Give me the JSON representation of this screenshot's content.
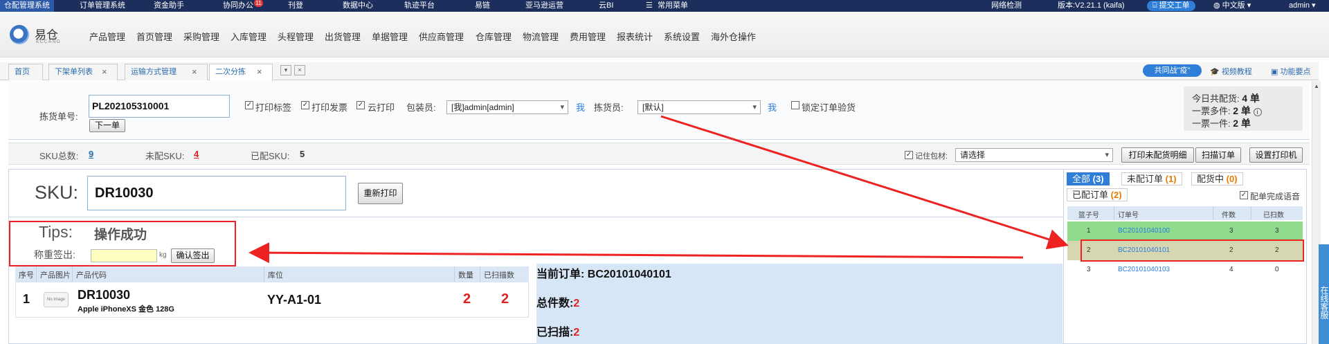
{
  "topbar": {
    "items": [
      "仓配管理系统",
      "订单管理系统",
      "资金助手",
      "协同办公",
      "刊登",
      "数据中心",
      "轨迹平台",
      "易链",
      "亚马逊运营",
      "云BI",
      "常用菜单"
    ],
    "badge": "11",
    "network": "网络检测",
    "version": "版本:V2.21.1 (kaifa)",
    "ticket": "提交工单",
    "lang": "中文版",
    "user": "admin"
  },
  "logo": {
    "name": "易仓",
    "sub": "ECCANG"
  },
  "menu": [
    "产品管理",
    "首页管理",
    "采购管理",
    "入库管理",
    "头程管理",
    "出货管理",
    "单据管理",
    "供应商管理",
    "仓库管理",
    "物流管理",
    "费用管理",
    "报表统计",
    "系统设置",
    "海外仓操作"
  ],
  "tabs": [
    "首页",
    "下架单列表",
    "运输方式管理",
    "二次分拣"
  ],
  "tab_tools": [
    "▾",
    "×"
  ],
  "top_links": {
    "banner": "共同战\"疫\"",
    "tutorial": "视频教程",
    "tips": "功能要点"
  },
  "form": {
    "pick_label": "拣货单号:",
    "pick_value": "PL202105310001",
    "next_btn": "下一单",
    "print_label": "打印标签",
    "print_invoice": "打印发票",
    "cloud_print": "云打印",
    "packer_label": "包装员:",
    "packer_value": "[我]admin[admin]",
    "me1": "我",
    "picker_label": "拣货员:",
    "picker_value": "[默认]",
    "me2": "我",
    "lock": "锁定订单验货",
    "check_mark": "✓"
  },
  "summary": {
    "l1": "今日共配货:",
    "v1": "4 单",
    "l2": "一票多件:",
    "v2": "2 单",
    "l3": "一票一件:",
    "v3": "2 单"
  },
  "stats": {
    "total_label": "SKU总数:",
    "total": "9",
    "unmatched_label": "未配SKU:",
    "unmatched": "4",
    "matched_label": "已配SKU:",
    "matched": "5",
    "remember": "记住包材:",
    "material": "请选择",
    "btn_print_unmatched": "打印未配货明细",
    "btn_scan": "扫描订单",
    "btn_printer": "设置打印机"
  },
  "sku": {
    "label": "SKU:",
    "value": "DR10030",
    "reprint": "重新打印"
  },
  "tips": {
    "label": "Tips:",
    "message": "操作成功"
  },
  "weigh": {
    "label": "称重签出:",
    "unit": "kg",
    "btn": "确认签出"
  },
  "table": {
    "headers": [
      "序号",
      "产品图片",
      "产品代码",
      "库位",
      "数量",
      "已扫描数"
    ],
    "row": {
      "seq": "1",
      "img": "No Image",
      "code": "DR10030",
      "name": "Apple iPhoneXS 金色 128G",
      "loc": "YY-A1-01",
      "qty": "2",
      "scanned": "2"
    }
  },
  "current": {
    "order_label": "当前订单:",
    "order": "BC20101040101",
    "total_label": "总件数:",
    "total": "2",
    "scanned_label": "已扫描:",
    "scanned": "2"
  },
  "right": {
    "tab_all": "全部",
    "c_all": "(3)",
    "tab_un": "未配订单",
    "c_un": "(1)",
    "tab_ing": "配货中",
    "c_ing": "(0)",
    "tab_done": "已配订单",
    "c_done": "(2)",
    "voice": "配单完成语音",
    "headers": [
      "篮子号",
      "订单号",
      "件数",
      "已扫数"
    ],
    "rows": [
      {
        "basket": "1",
        "order": "BC20101040100",
        "qty": "3",
        "scanned": "3"
      },
      {
        "basket": "2",
        "order": "BC20101040101",
        "qty": "2",
        "scanned": "2"
      },
      {
        "basket": "3",
        "order": "BC20101040103",
        "qty": "4",
        "scanned": "0"
      }
    ]
  },
  "online": "在线客服",
  "colors": {
    "topbar": "#1c2f5c",
    "accent": "#2f7ed8",
    "row_green": "#8fdc8f",
    "row_selected": "#d6d6b0",
    "annotation": "#e22222"
  }
}
